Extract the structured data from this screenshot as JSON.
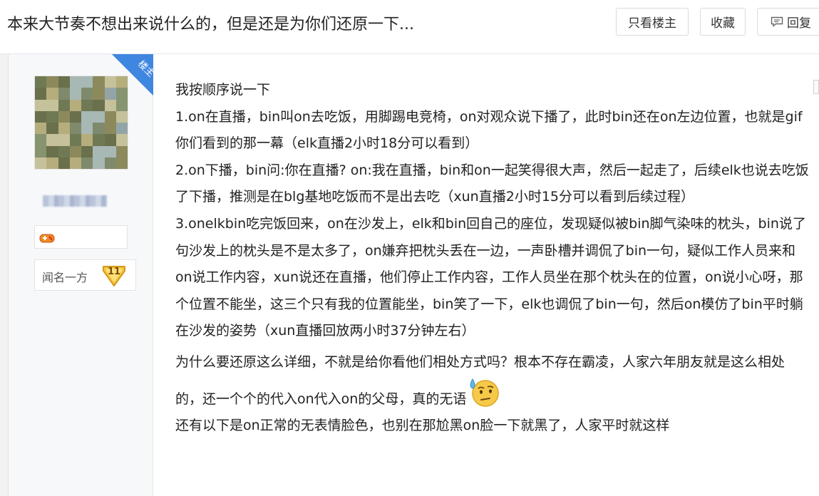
{
  "header": {
    "title": "本来大节奏不想出来说什么的，但是还是为你们还原一下...",
    "only_author_label": "只看楼主",
    "collect_label": "收藏",
    "reply_label": "回复"
  },
  "author": {
    "badge_label": "楼主",
    "level_name": "闻名一方",
    "level_number": "11"
  },
  "post": {
    "paragraphs": [
      "我按顺序说一下",
      "1.on在直播，bin叫on去吃饭，用脚踢电竞椅，on对观众说下播了，此时bin还在on左边位置，也就是gif你们看到的那一幕（elk直播2小时18分可以看到）",
      "2.on下播，bin问:你在直播? on:我在直播，bin和on一起笑得很大声，然后一起走了，后续elk也说去吃饭了下播，推测是在blg基地吃饭而不是出去吃（xun直播2小时15分可以看到后续过程）",
      "3.onelkbin吃完饭回来，on在沙发上，elk和bin回自己的座位，发现疑似被bin脚气染味的枕头，bin说了句沙发上的枕头是不是太多了，on嫌弃把枕头丢在一边，一声卧槽并调侃了bin一句，疑似工作人员来和on说工作内容，xun说还在直播，他们停止工作内容，工作人员坐在那个枕头在的位置，on说小心呀，那个位置不能坐，这三个只有我的位置能坐，bin笑了一下，elk也调侃了bin一句，然后on模仿了bin平时躺在沙发的姿势（xun直播回放两小时37分钟左右）",
      "为什么要还原这么详细，不就是给你看他们相处方式吗？根本不存在霸凌，人家六年朋友就是这么相处的，还一个个的代入on代入on的父母，真的无语",
      "还有以下是on正常的无表情脸色，也别在那尬黑on脸一下就黑了，人家平时就这样"
    ],
    "emoji_icon": "sweat-thinking-emoji-icon"
  },
  "colors": {
    "badge_blue": "#3f86e0",
    "level_gold": "#f5c542"
  }
}
